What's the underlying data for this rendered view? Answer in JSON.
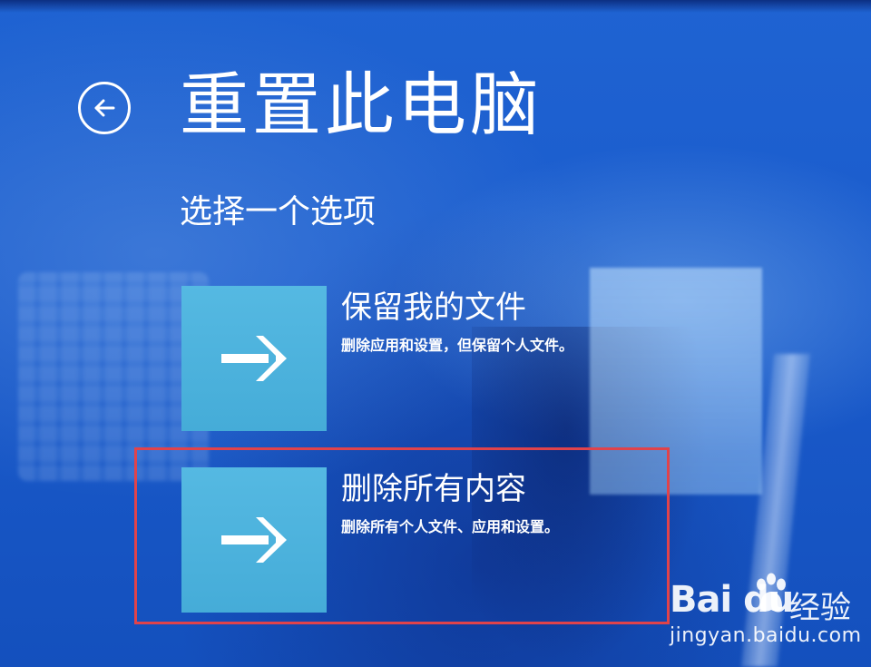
{
  "screen": {
    "title": "重置此电脑",
    "subtitle": "选择一个选项"
  },
  "options": [
    {
      "title": "保留我的文件",
      "description": "删除应用和设置，但保留个人文件。",
      "icon": "arrow-right-icon"
    },
    {
      "title": "删除所有内容",
      "description": "删除所有个人文件、应用和设置。",
      "icon": "arrow-right-icon"
    }
  ],
  "back_icon": "back-arrow-icon",
  "watermark": {
    "logo": "Bai du",
    "product": "经验",
    "url": "jingyan.baidu.com"
  },
  "colors": {
    "background": "#1a5bcc",
    "tile": "#4fb3de",
    "highlight": "#e0434b",
    "text": "#ffffff"
  }
}
